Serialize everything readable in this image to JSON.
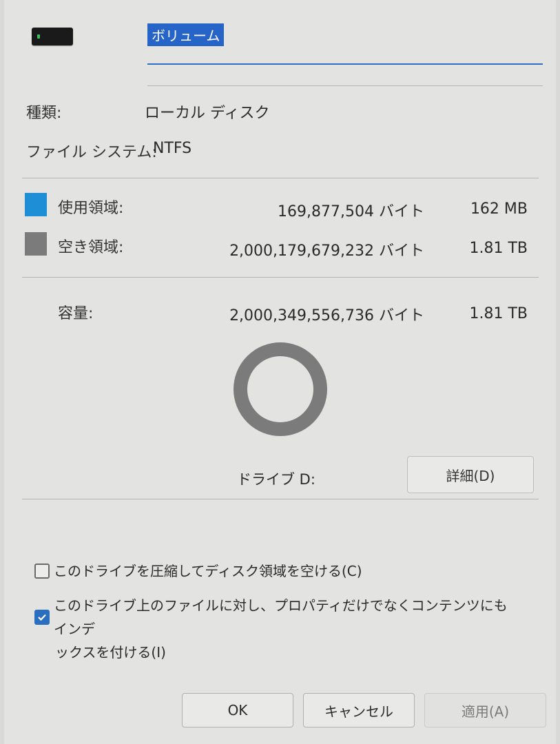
{
  "header": {
    "volume_name": "ボリューム"
  },
  "info": {
    "type_label": "種類:",
    "type_value": "ローカル ディスク",
    "fs_label": "ファイル システム:",
    "fs_value": "NTFS"
  },
  "usage": {
    "used_label": "使用領域:",
    "used_bytes": "169,877,504 バイト",
    "used_size": "162 MB",
    "used_color": "#1e8fd6",
    "free_label": "空き領域:",
    "free_bytes": "2,000,179,679,232 バイト",
    "free_size": "1.81 TB",
    "free_color": "#7b7b7b",
    "capacity_label": "容量:",
    "capacity_bytes": "2,000,349,556,736 バイト",
    "capacity_size": "1.81 TB",
    "used_fraction": 8.49e-05
  },
  "drive": {
    "label": "ドライブ D:",
    "details_button": "詳細(D)"
  },
  "options": {
    "compress_label": "このドライブを圧縮してディスク領域を空ける(C)",
    "compress_checked": false,
    "index_label_line1": "このドライブ上のファイルに対し、プロパティだけでなくコンテンツにもインデ",
    "index_label_line2": "ックスを付ける(I)",
    "index_checked": true
  },
  "buttons": {
    "ok": "OK",
    "cancel": "キャンセル",
    "apply": "適用(A)"
  }
}
